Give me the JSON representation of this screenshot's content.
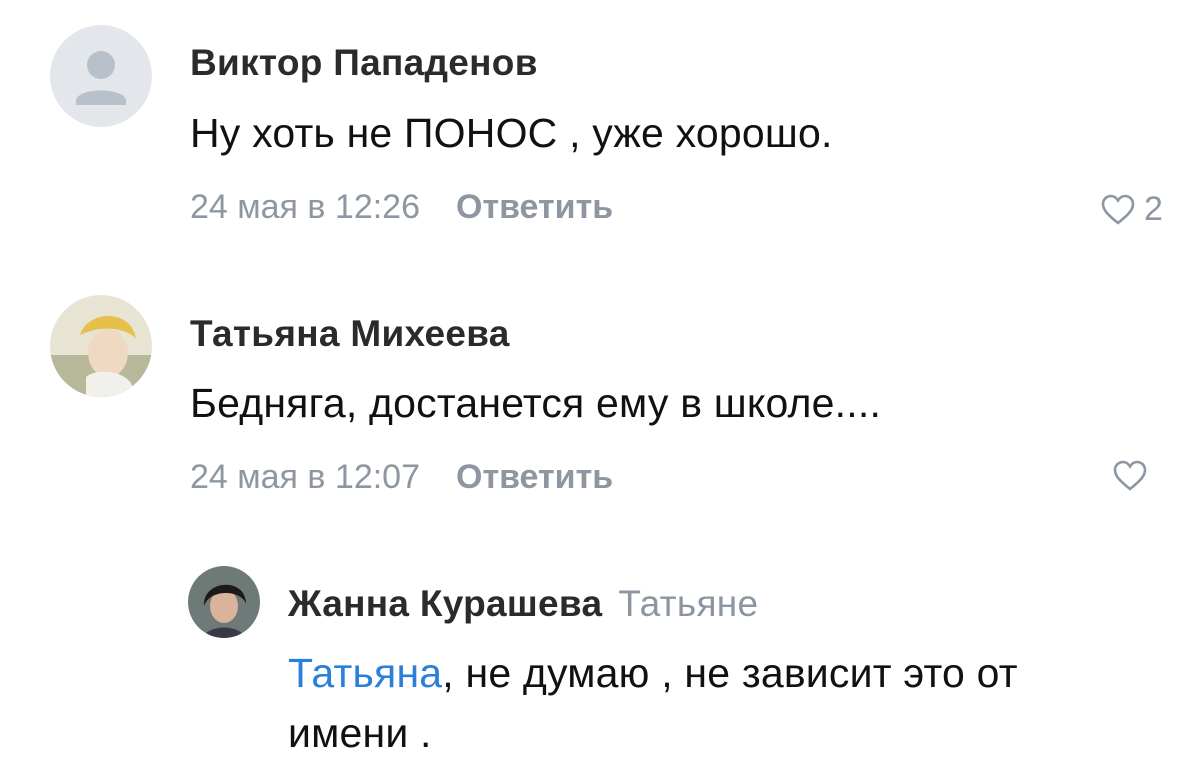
{
  "comments": [
    {
      "author": "Виктор Пападенов",
      "text": "Ну хоть не ПОНОС , уже хорошо.",
      "date": "24 мая в 12:26",
      "reply_label": "Ответить",
      "likes": "2",
      "avatar": "default-user-icon"
    },
    {
      "author": "Татьяна Михеева",
      "text": "Бедняга, достанется ему в школе....",
      "date": "24 мая в 12:07",
      "reply_label": "Ответить",
      "likes": "",
      "avatar": "user-photo"
    }
  ],
  "reply": {
    "author": "Жанна Курашева",
    "reply_to": "Татьяне",
    "mention": "Татьяна",
    "text": ", не думаю , не зависит это от имени .",
    "avatar": "user-photo"
  },
  "colors": {
    "mention": "#2a7fd8",
    "meta": "#8e97a1",
    "default_avatar_bg": "#e3e6ea"
  }
}
